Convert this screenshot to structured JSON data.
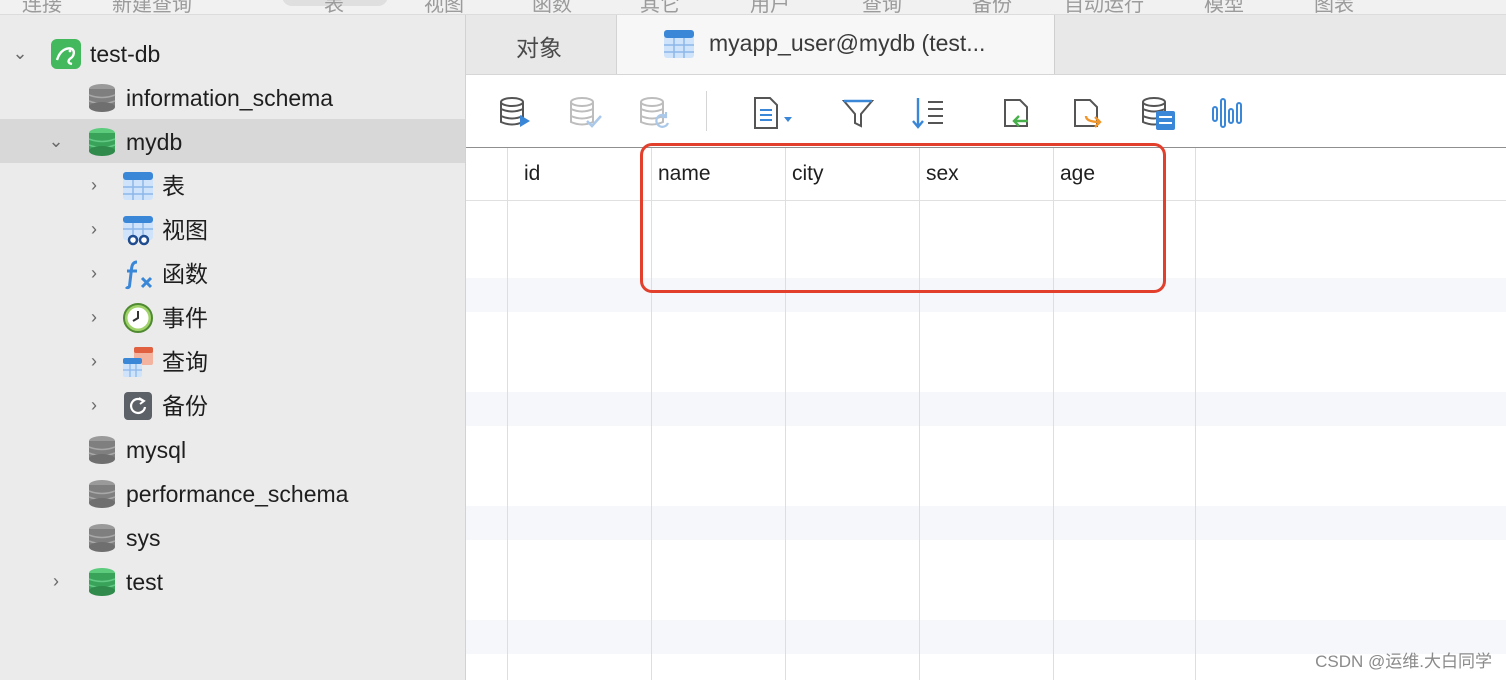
{
  "topbar": {
    "items": [
      "连接",
      "新建查询",
      "表",
      "视图",
      "函数",
      "其它",
      "用户",
      "查询",
      "备份",
      "自动运行",
      "模型",
      "图表"
    ]
  },
  "sidebar": {
    "items": [
      {
        "label": "test-db",
        "icon": "mysql-connection-icon",
        "expander": "v"
      },
      {
        "label": "information_schema",
        "icon": "database-icon-gray",
        "expander": ""
      },
      {
        "label": "mydb",
        "icon": "database-icon-green",
        "expander": "v",
        "selected": true
      },
      {
        "label": "表",
        "icon": "table-icon",
        "expander": ">"
      },
      {
        "label": "视图",
        "icon": "view-icon",
        "expander": ">"
      },
      {
        "label": "函数",
        "icon": "function-icon",
        "expander": ">"
      },
      {
        "label": "事件",
        "icon": "clock-icon",
        "expander": ">"
      },
      {
        "label": "查询",
        "icon": "query-icon",
        "expander": ">"
      },
      {
        "label": "备份",
        "icon": "backup-icon",
        "expander": ">"
      },
      {
        "label": "mysql",
        "icon": "database-icon-gray",
        "expander": ""
      },
      {
        "label": "performance_schema",
        "icon": "database-icon-gray",
        "expander": ""
      },
      {
        "label": "sys",
        "icon": "database-icon-gray",
        "expander": ""
      },
      {
        "label": "test",
        "icon": "database-icon-green",
        "expander": ">"
      }
    ]
  },
  "tabs": {
    "objects": "对象",
    "active": "myapp_user@mydb (test..."
  },
  "toolbar": {
    "icons": [
      "begin-transaction-icon",
      "commit-icon",
      "rollback-icon",
      "text-view-icon",
      "filter-icon",
      "sort-icon",
      "import-icon",
      "export-icon",
      "data-generator-icon",
      "chart-icon"
    ]
  },
  "grid": {
    "columns": [
      "id",
      "name",
      "city",
      "sex",
      "age"
    ],
    "rows": []
  },
  "watermark": "CSDN @运维.大白同学",
  "colors": {
    "highlight": "#e23f2d",
    "mysql_green": "#3fb55b",
    "db_gray": "#7d7d7d",
    "db_green": "#3aa35a",
    "toolbar_blue": "#3a87d8"
  }
}
